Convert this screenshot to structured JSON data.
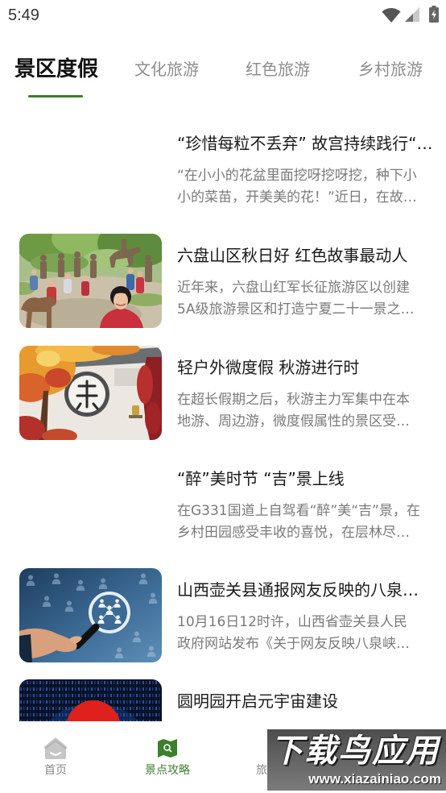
{
  "status_bar": {
    "time": "5:49",
    "icons": [
      "wifi-icon",
      "signal-icon",
      "battery-charging-icon"
    ]
  },
  "tabs": [
    {
      "label": "景区度假",
      "active": true
    },
    {
      "label": "文化旅游",
      "active": false
    },
    {
      "label": "红色旅游",
      "active": false
    },
    {
      "label": "乡村旅游",
      "active": false
    }
  ],
  "articles": [
    {
      "title": "“珍惜每粒不丢弃” 故宫持续践行“…",
      "desc_lines": [
        "“在小小的花盆里面挖呀挖呀挖，种下小",
        "小的菜苗，开美美的花！”近日，在故…"
      ]
    },
    {
      "title": "六盘山区秋日好 红色故事最动人",
      "desc_lines": [
        "近年来，六盘山红军长征旅游区以创建",
        "5A级旅游景区和打造宁夏二十一景之…"
      ]
    },
    {
      "title": "轻户外微度假 秋游进行时",
      "desc_lines": [
        "在超长假期之后，秋游主力军集中在本",
        "地游、周边游，微度假属性的景区受…"
      ]
    },
    {
      "title": "“醉”美时节 “吉”景上线",
      "desc_lines": [
        "在G331国道上自驾看“醉”美“吉”景，在",
        "乡村田园感受丰收的喜悦，在层林尽…"
      ]
    },
    {
      "title": "山西壶关县通报网友反映的八泉…",
      "desc_lines": [
        "10月16日12时许，山西省壶关县人民",
        "政府网站发布《关于网友反映八泉峡…"
      ]
    },
    {
      "title": "圆明园开启元宇宙建设",
      "desc_lines": []
    }
  ],
  "bottom_nav": [
    {
      "label": "首页",
      "icon": "home-icon",
      "active": false
    },
    {
      "label": "景点攻略",
      "icon": "map-search-icon",
      "active": true
    },
    {
      "label": "旅",
      "active": false
    }
  ],
  "watermark": {
    "title": "下载鸟应用",
    "url": "www.xiazainiao.com"
  },
  "colors": {
    "accent": "#3c7f2d",
    "title_text": "#1a1a1a",
    "secondary_text": "#7a7a7a",
    "tab_inactive": "#8e8e8e",
    "nav_inactive": "#8a8a8a"
  }
}
